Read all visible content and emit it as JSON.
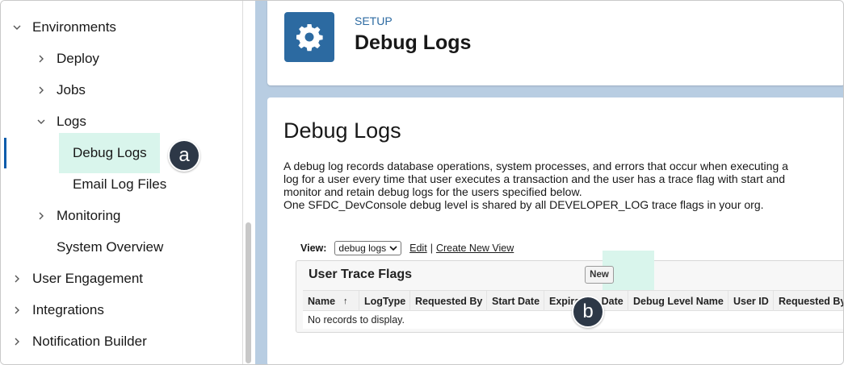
{
  "sidebar": {
    "items": [
      {
        "label": "Environments",
        "chevron": "down"
      },
      {
        "label": "Deploy",
        "chevron": "right"
      },
      {
        "label": "Jobs",
        "chevron": "right"
      },
      {
        "label": "Logs",
        "chevron": "down"
      },
      {
        "label": "Debug Logs",
        "chevron": "none"
      },
      {
        "label": "Email Log Files",
        "chevron": "none"
      },
      {
        "label": "Monitoring",
        "chevron": "right"
      },
      {
        "label": "System Overview",
        "chevron": "none"
      },
      {
        "label": "User Engagement",
        "chevron": "right"
      },
      {
        "label": "Integrations",
        "chevron": "right"
      },
      {
        "label": "Notification Builder",
        "chevron": "right"
      }
    ]
  },
  "header": {
    "section": "SETUP",
    "title": "Debug Logs",
    "icon": "gear-icon"
  },
  "main": {
    "page_title": "Debug Logs",
    "description": [
      "A debug log records database operations, system processes, and errors that occur when executing a",
      "log for a user every time that user executes a transaction and the user has a trace flag with start and",
      "monitor and retain debug logs for the users specified below.",
      "One SFDC_DevConsole debug level is shared by all DEVELOPER_LOG trace flags in your org."
    ],
    "view": {
      "label": "View:",
      "selected": "debug logs",
      "edit": "Edit",
      "separator": "|",
      "create": "Create New View"
    },
    "trace_flags": {
      "title": "User Trace Flags",
      "new_button": "New",
      "columns": [
        "Name",
        "LogType",
        "Requested By",
        "Start Date",
        "Expiration Date",
        "Debug Level Name",
        "User ID",
        "Requested By I"
      ],
      "empty_message": "No records to display."
    }
  },
  "callouts": {
    "a": "a",
    "b": "b"
  },
  "colors": {
    "accent": "#2c6aa1",
    "highlight": "#d9f5ec",
    "callout": "#2d3847",
    "background": "#b8cde2"
  }
}
